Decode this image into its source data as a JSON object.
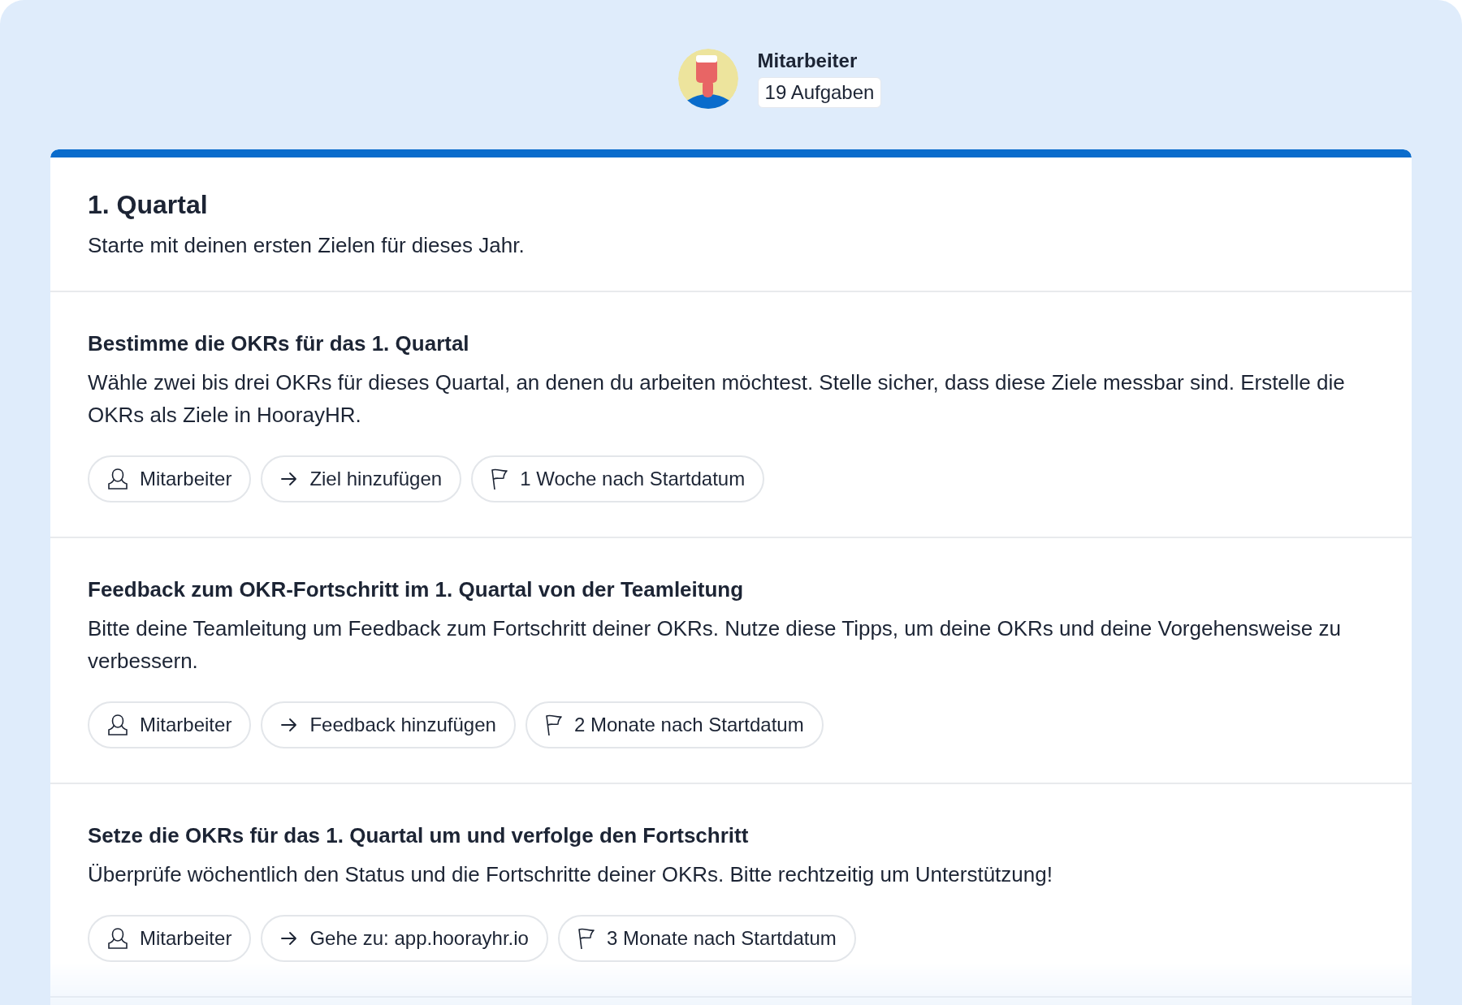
{
  "assignee": {
    "name": "Mitarbeiter",
    "task_count": "19 Aufgaben"
  },
  "phase": {
    "title": "1. Quartal",
    "subtitle": "Starte mit deinen ersten Zielen für dieses Jahr."
  },
  "tasks": [
    {
      "title": "Bestimme die OKRs für das 1. Quartal",
      "description": "Wähle zwei bis drei OKRs für dieses Quartal, an denen du arbeiten möchtest. Stelle sicher, dass diese Ziele messbar sind. Erstelle die OKRs als Ziele in HoorayHR.",
      "chips": [
        {
          "kind": "person",
          "label": "Mitarbeiter"
        },
        {
          "kind": "action",
          "label": "Ziel hinzufügen"
        },
        {
          "kind": "due",
          "label": "1 Woche nach Startdatum"
        }
      ]
    },
    {
      "title": "Feedback zum OKR-Fortschritt im 1. Quartal von der Teamleitung",
      "description": "Bitte deine Teamleitung um Feedback zum Fortschritt deiner OKRs. Nutze diese Tipps, um deine OKRs und deine Vorgehensweise zu verbessern.",
      "chips": [
        {
          "kind": "person",
          "label": "Mitarbeiter"
        },
        {
          "kind": "action",
          "label": "Feedback hinzufügen"
        },
        {
          "kind": "due",
          "label": "2 Monate nach Startdatum"
        }
      ]
    },
    {
      "title": "Setze die OKRs für das 1. Quartal um und verfolge den Fortschritt",
      "description": "Überprüfe wöchentlich den Status und die Fortschritte deiner OKRs. Bitte rechtzeitig um Unterstützung!",
      "chips": [
        {
          "kind": "person",
          "label": "Mitarbeiter"
        },
        {
          "kind": "action",
          "label": "Gehe zu: app.hoorayhr.io"
        },
        {
          "kind": "due",
          "label": "3 Monate nach Startdatum"
        }
      ]
    }
  ]
}
